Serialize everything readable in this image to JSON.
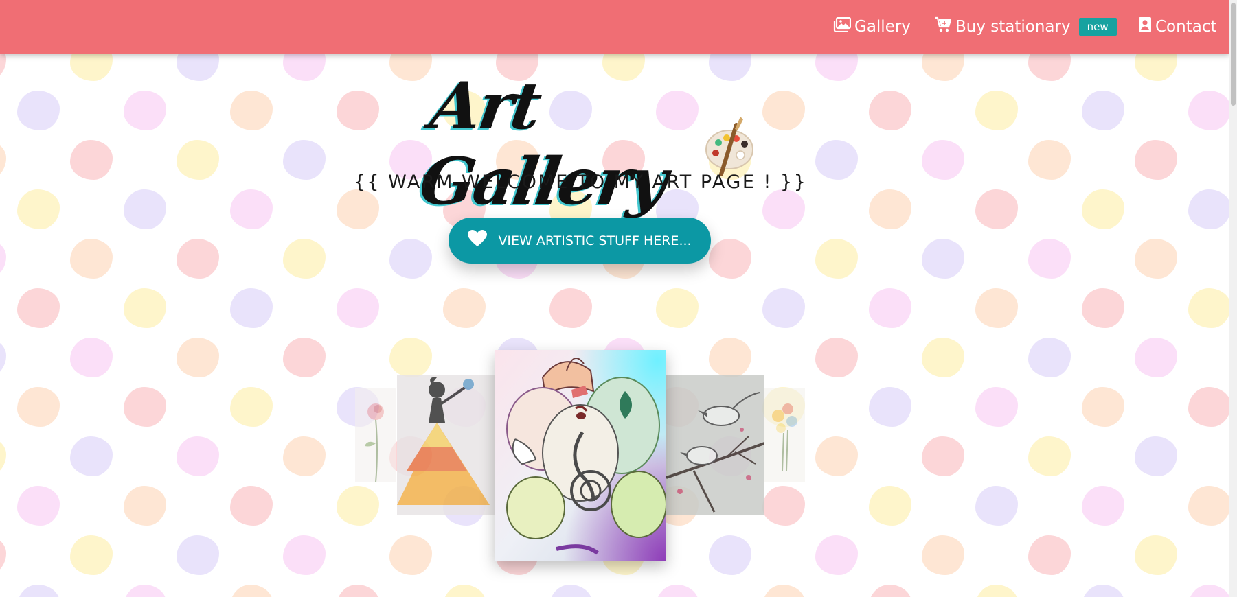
{
  "navbar": {
    "background_color": "#f06e74",
    "items": [
      {
        "label": "Gallery",
        "icon": "images-icon"
      },
      {
        "label": "Buy stationary",
        "icon": "cart-icon",
        "badge": "new"
      },
      {
        "label": "Contact",
        "icon": "contact-card-icon"
      }
    ]
  },
  "hero": {
    "logo_text": "Art Gallery",
    "logo_icon": "palette-icon",
    "welcome": "{{ WARM WELCOME TO MY ART PAGE ! }}",
    "cta_label": "VIEW ARTISTIC STUFF HERE...",
    "cta_icon": "heart-icon",
    "cta_color": "#0c98a4"
  },
  "carousel": {
    "slides": [
      {
        "subject": "rose-sketch"
      },
      {
        "subject": "girl-silhouette-dress"
      },
      {
        "subject": "ganesha-painting"
      },
      {
        "subject": "birds-on-branch"
      },
      {
        "subject": "flower-bouquet"
      }
    ]
  }
}
